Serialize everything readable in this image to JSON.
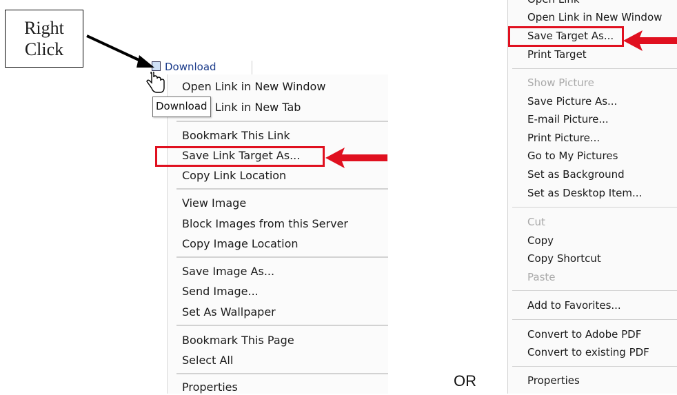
{
  "callout": {
    "line1": "Right",
    "line2": "Click"
  },
  "firefox": {
    "link_label": "Download",
    "tooltip": "Download",
    "items": [
      {
        "label": "Open Link in New Window"
      },
      {
        "label": "Open Link in New Tab"
      },
      {
        "label": "Bookmark This Link"
      },
      {
        "label": "Save Link Target As...",
        "highlighted": true
      },
      {
        "label": "Copy Link Location"
      },
      {
        "label": "View Image"
      },
      {
        "label": "Block Images from this Server"
      },
      {
        "label": "Copy Image Location"
      },
      {
        "label": "Save Image As..."
      },
      {
        "label": "Send Image..."
      },
      {
        "label": "Set As Wallpaper"
      },
      {
        "label": "Bookmark This Page"
      },
      {
        "label": "Select All"
      },
      {
        "label": "Properties"
      }
    ]
  },
  "ie": {
    "items": [
      {
        "label": "Open Link"
      },
      {
        "label": "Open Link in New Window"
      },
      {
        "label": "Save Target As...",
        "highlighted": true
      },
      {
        "label": "Print Target"
      },
      {
        "label": "Show Picture",
        "disabled": true
      },
      {
        "label": "Save Picture As..."
      },
      {
        "label": "E-mail Picture..."
      },
      {
        "label": "Print Picture..."
      },
      {
        "label": "Go to My Pictures"
      },
      {
        "label": "Set as Background"
      },
      {
        "label": "Set as Desktop Item..."
      },
      {
        "label": "Cut",
        "disabled": true
      },
      {
        "label": "Copy"
      },
      {
        "label": "Copy Shortcut"
      },
      {
        "label": "Paste",
        "disabled": true
      },
      {
        "label": "Add to Favorites..."
      },
      {
        "label": "Convert to Adobe PDF"
      },
      {
        "label": "Convert to existing PDF"
      },
      {
        "label": "Properties"
      }
    ]
  },
  "or_label": "OR",
  "colors": {
    "highlight": "#e0101f",
    "separator": "#d2d2d2",
    "disabled": "#a9a9a9"
  }
}
